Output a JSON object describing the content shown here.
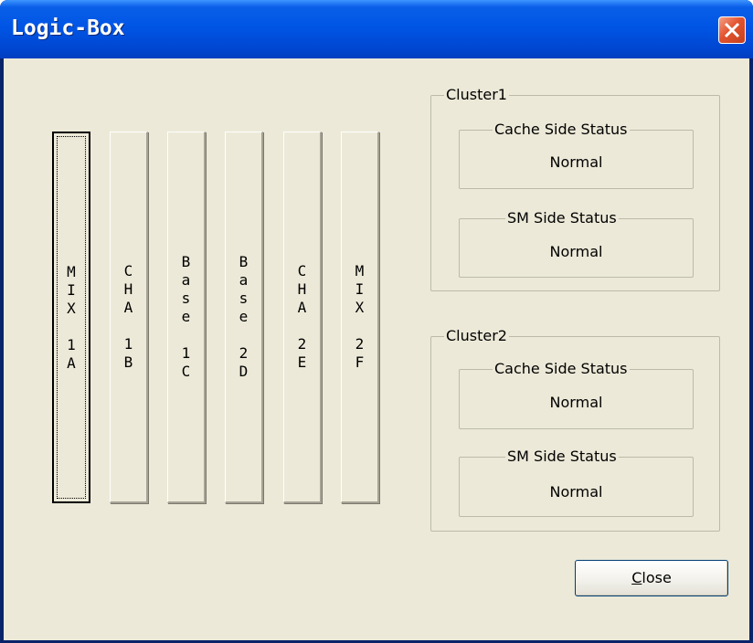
{
  "window": {
    "title": "Logic-Box"
  },
  "slots": [
    {
      "chars": [
        "M",
        "I",
        "X",
        "",
        "1",
        "A"
      ],
      "focused": true
    },
    {
      "chars": [
        "C",
        "H",
        "A",
        "",
        "1",
        "B"
      ],
      "focused": false
    },
    {
      "chars": [
        "B",
        "a",
        "s",
        "e",
        "",
        "1",
        "C"
      ],
      "focused": false
    },
    {
      "chars": [
        "B",
        "a",
        "s",
        "e",
        "",
        "2",
        "D"
      ],
      "focused": false
    },
    {
      "chars": [
        "C",
        "H",
        "A",
        "",
        "2",
        "E"
      ],
      "focused": false
    },
    {
      "chars": [
        "M",
        "I",
        "X",
        "",
        "2",
        "F"
      ],
      "focused": false
    }
  ],
  "clusters": [
    {
      "label": "Cluster1",
      "cache": {
        "label": "Cache Side Status",
        "value": "Normal"
      },
      "sm": {
        "label": "SM Side Status",
        "value": "Normal"
      }
    },
    {
      "label": "Cluster2",
      "cache": {
        "label": "Cache Side Status",
        "value": "Normal"
      },
      "sm": {
        "label": "SM Side Status",
        "value": "Normal"
      }
    }
  ],
  "buttons": {
    "close_mnemonic": "C",
    "close_rest": "lose"
  },
  "colors": {
    "titlebar": "#0055e5",
    "dialog_bg": "#ece9d8",
    "close_red": "#e2532f"
  }
}
